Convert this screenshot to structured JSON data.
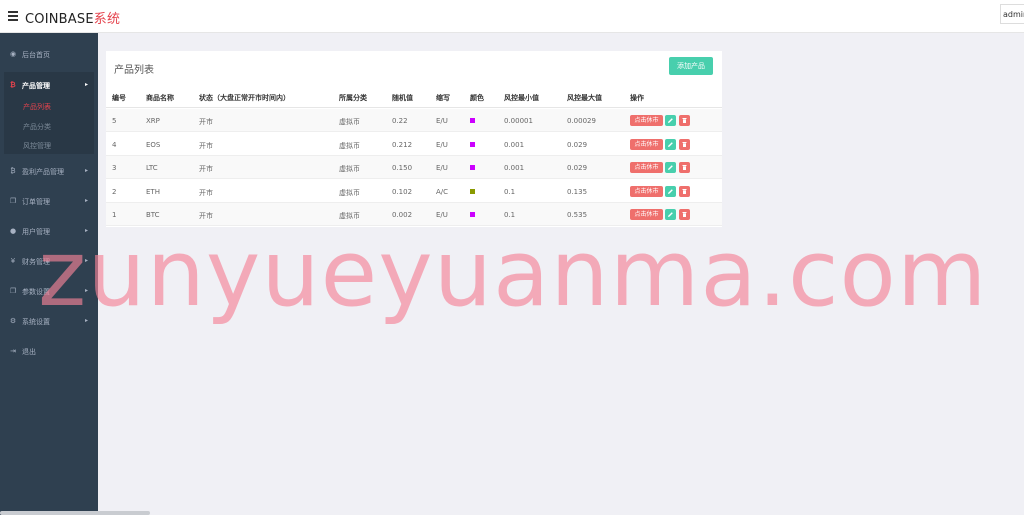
{
  "app": {
    "brand_main": "COINBASE",
    "brand_accent": "系统",
    "admin_label": "admin"
  },
  "sidebar": {
    "items": [
      {
        "label": "后台首页",
        "icon": "dashboard-icon"
      },
      {
        "label": "产品管理",
        "icon": "bitcoin-icon",
        "expanded": true,
        "children": [
          "产品列表",
          "产品分类",
          "风控管理"
        ],
        "active_child": "产品列表"
      },
      {
        "label": "盈利产品管理",
        "icon": "bitcoin-icon"
      },
      {
        "label": "订单管理",
        "icon": "copy-icon"
      },
      {
        "label": "用户管理",
        "icon": "user-icon"
      },
      {
        "label": "财务管理",
        "icon": "yen-icon"
      },
      {
        "label": "参数设置",
        "icon": "copy-icon"
      },
      {
        "label": "系统设置",
        "icon": "gears-icon"
      },
      {
        "label": "退出",
        "icon": "sign-out-icon"
      }
    ]
  },
  "panel": {
    "title": "产品列表",
    "add_button": "添加产品",
    "columns": [
      "编号",
      "商品名称",
      "状态（大盘正常开市时间内）",
      "所属分类",
      "随机值",
      "缩写",
      "颜色",
      "风控最小值",
      "风控最大值",
      "操作"
    ],
    "rows": [
      {
        "id": "5",
        "name": "XRP",
        "status": "开市",
        "category": "虚拟币",
        "random": "0.22",
        "abbr": "E/U",
        "color": "#cc00ff",
        "min": "0.00001",
        "max": "0.00029"
      },
      {
        "id": "4",
        "name": "EOS",
        "status": "开市",
        "category": "虚拟币",
        "random": "0.212",
        "abbr": "E/U",
        "color": "#cc00ff",
        "min": "0.001",
        "max": "0.029"
      },
      {
        "id": "3",
        "name": "LTC",
        "status": "开市",
        "category": "虚拟币",
        "random": "0.150",
        "abbr": "E/U",
        "color": "#cc00ff",
        "min": "0.001",
        "max": "0.029"
      },
      {
        "id": "2",
        "name": "ETH",
        "status": "开市",
        "category": "虚拟币",
        "random": "0.102",
        "abbr": "A/C",
        "color": "#8a9a00",
        "min": "0.1",
        "max": "0.135"
      },
      {
        "id": "1",
        "name": "BTC",
        "status": "开市",
        "category": "虚拟币",
        "random": "0.002",
        "abbr": "E/U",
        "color": "#cc00ff",
        "min": "0.1",
        "max": "0.535"
      }
    ],
    "stop_label": "点击休市"
  },
  "watermark": "zunyueyuanma.com",
  "colors": {
    "accent": "#e5434d",
    "teal": "#48cfad",
    "sidebar_bg": "#2f4050",
    "danger": "#ef6f6c"
  }
}
